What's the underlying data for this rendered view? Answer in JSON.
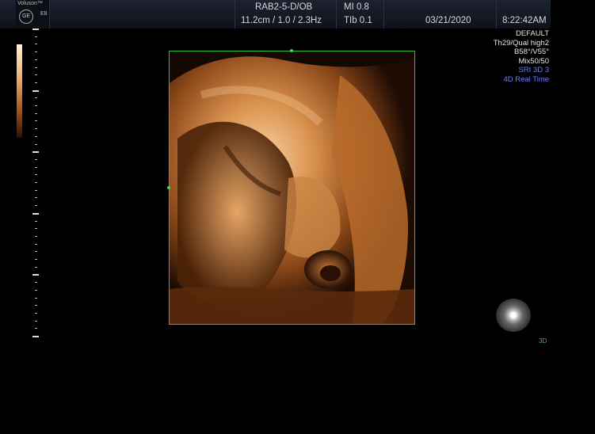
{
  "brand": {
    "name": "Voluson™",
    "model": "E8",
    "logo": "GE"
  },
  "header": {
    "probe": "RAB2-5-D/OB",
    "mi": "MI 0.8",
    "depth_freq": "11.2cm / 1.0 / 2.3Hz",
    "tib": "TIb 0.1",
    "date": "03/21/2020",
    "time": "8:22:42AM"
  },
  "settings": [
    "DEFAULT",
    "Th29/Qual high2",
    "B58°/V55°",
    "Mix50/50"
  ],
  "modes": [
    "SRI 3D 3",
    "4D Real Time"
  ],
  "mode_color": "#6f7bff",
  "roi_color": "#2fc13a",
  "render_label": "3D"
}
